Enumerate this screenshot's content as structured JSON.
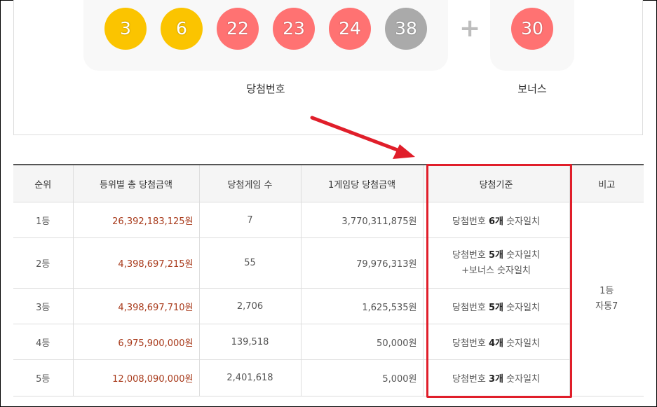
{
  "winning": {
    "numbers": [
      {
        "value": "3",
        "color": "#fbc400"
      },
      {
        "value": "6",
        "color": "#fbc400"
      },
      {
        "value": "22",
        "color": "#ff7272"
      },
      {
        "value": "23",
        "color": "#ff7272"
      },
      {
        "value": "24",
        "color": "#ff7272"
      },
      {
        "value": "38",
        "color": "#aaaaaa"
      }
    ],
    "plus_symbol": "+",
    "bonus": {
      "value": "30",
      "color": "#ff7272"
    },
    "numbers_label": "당첨번호",
    "bonus_label": "보너스"
  },
  "table": {
    "headers": [
      "순위",
      "등위별 총 당첨금액",
      "당첨게임 수",
      "1게임당 당첨금액",
      "당첨기준",
      "비고"
    ],
    "rows": [
      {
        "rank": "1등",
        "total": "26,392,183,125원",
        "games": "7",
        "per_game": "3,770,311,875원",
        "std_prefix": "당첨번호 ",
        "std_bold": "6개",
        "std_suffix": " 숫자일치",
        "std_line2": ""
      },
      {
        "rank": "2등",
        "total": "4,398,697,215원",
        "games": "55",
        "per_game": "79,976,313원",
        "std_prefix": "당첨번호 ",
        "std_bold": "5개",
        "std_suffix": " 숫자일치",
        "std_line2": "+보너스 숫자일치"
      },
      {
        "rank": "3등",
        "total": "4,398,697,710원",
        "games": "2,706",
        "per_game": "1,625,535원",
        "std_prefix": "당첨번호 ",
        "std_bold": "5개",
        "std_suffix": " 숫자일치",
        "std_line2": ""
      },
      {
        "rank": "4등",
        "total": "6,975,900,000원",
        "games": "139,518",
        "per_game": "50,000원",
        "std_prefix": "당첨번호 ",
        "std_bold": "4개",
        "std_suffix": " 숫자일치",
        "std_line2": ""
      },
      {
        "rank": "5등",
        "total": "12,008,090,000원",
        "games": "2,401,618",
        "per_game": "5,000원",
        "std_prefix": "당첨번호 ",
        "std_bold": "3개",
        "std_suffix": " 숫자일치",
        "std_line2": ""
      }
    ],
    "note_line1": "1등",
    "note_line2": "자동7"
  },
  "annotation": {
    "arrow_color": "#e01e2a",
    "box_color": "#e01e2a"
  }
}
